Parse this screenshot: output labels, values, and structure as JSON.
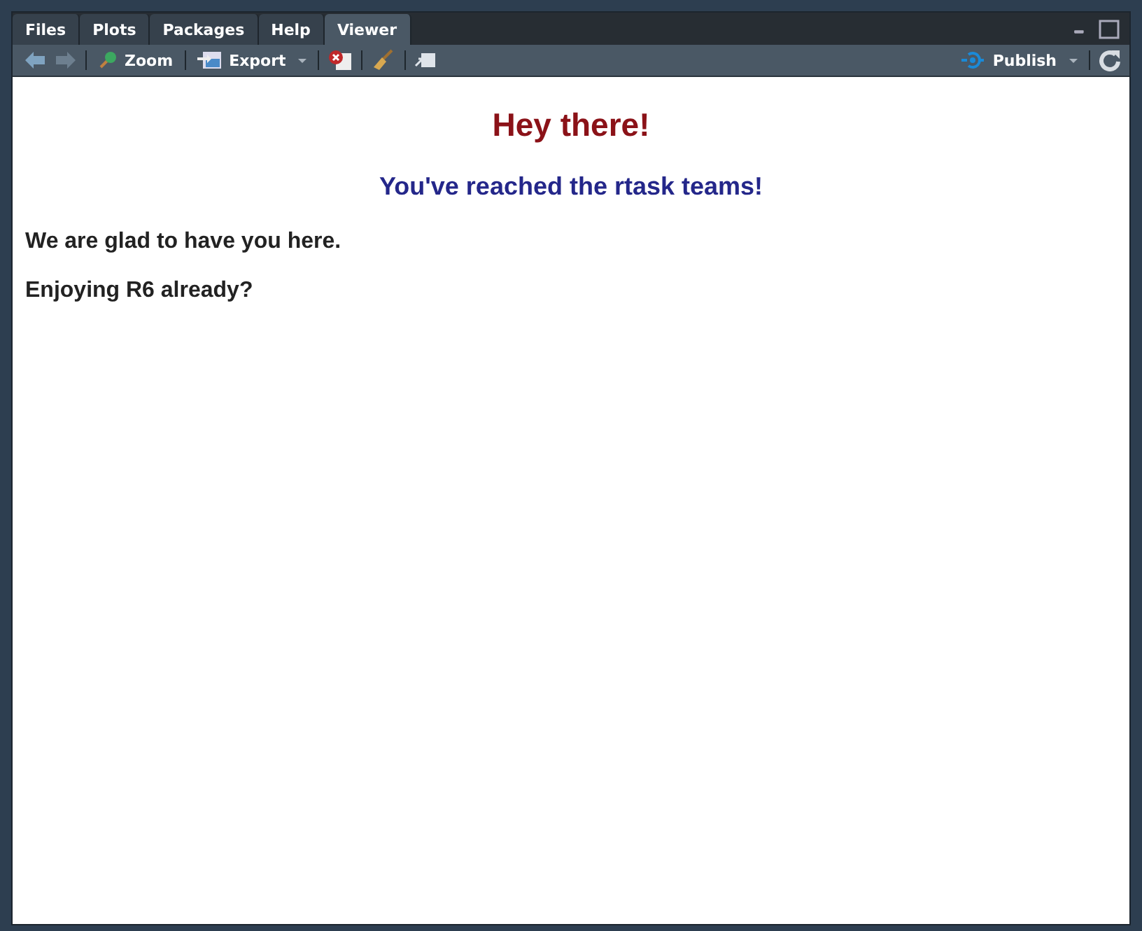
{
  "tabs": [
    {
      "label": "Files",
      "selected": false
    },
    {
      "label": "Plots",
      "selected": false
    },
    {
      "label": "Packages",
      "selected": false
    },
    {
      "label": "Help",
      "selected": false
    },
    {
      "label": "Viewer",
      "selected": true
    }
  ],
  "toolbar": {
    "zoom": "Zoom",
    "export": "Export",
    "publish": "Publish"
  },
  "content": {
    "heading": "Hey there!",
    "subheading": "You've reached the rtask teams!",
    "paragraphs": [
      "We are glad to have you here.",
      "Enjoying R6 already?"
    ]
  }
}
